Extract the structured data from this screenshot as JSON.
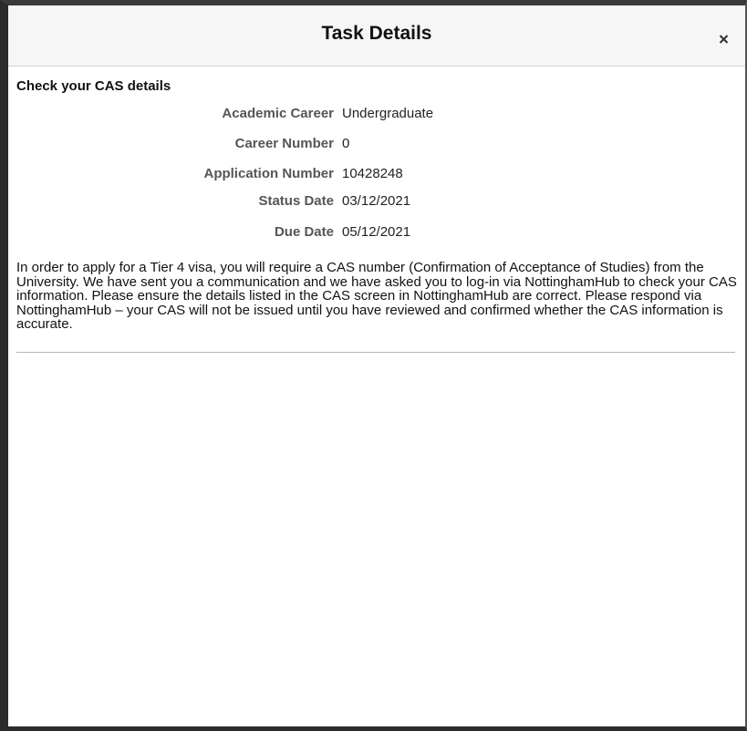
{
  "dialog": {
    "title": "Task Details",
    "close_icon": "close-icon"
  },
  "section": {
    "title": "Check your CAS details"
  },
  "fields": [
    {
      "label": "Academic Career",
      "value": "Undergraduate"
    },
    {
      "label": "Career Number",
      "value": "0"
    },
    {
      "label": "Application Number",
      "value": "10428248"
    },
    {
      "label": "Status Date",
      "value": "03/12/2021"
    },
    {
      "label": "Due Date",
      "value": "05/12/2021"
    }
  ],
  "description": "In order to apply for a Tier 4 visa, you will require a CAS number (Confirmation of Acceptance of Studies) from the University. We have sent you a communication and we have asked you to log-in via NottinghamHub to check your CAS information. Please ensure the details listed in the CAS screen in NottinghamHub are correct. Please respond via NottinghamHub – your CAS will not be issued until you have reviewed and confirmed whether the CAS information is accurate.",
  "colors": {
    "header_background": "#f6f6f6",
    "label_text": "#555555",
    "frame_border": "#2b2b2b"
  }
}
